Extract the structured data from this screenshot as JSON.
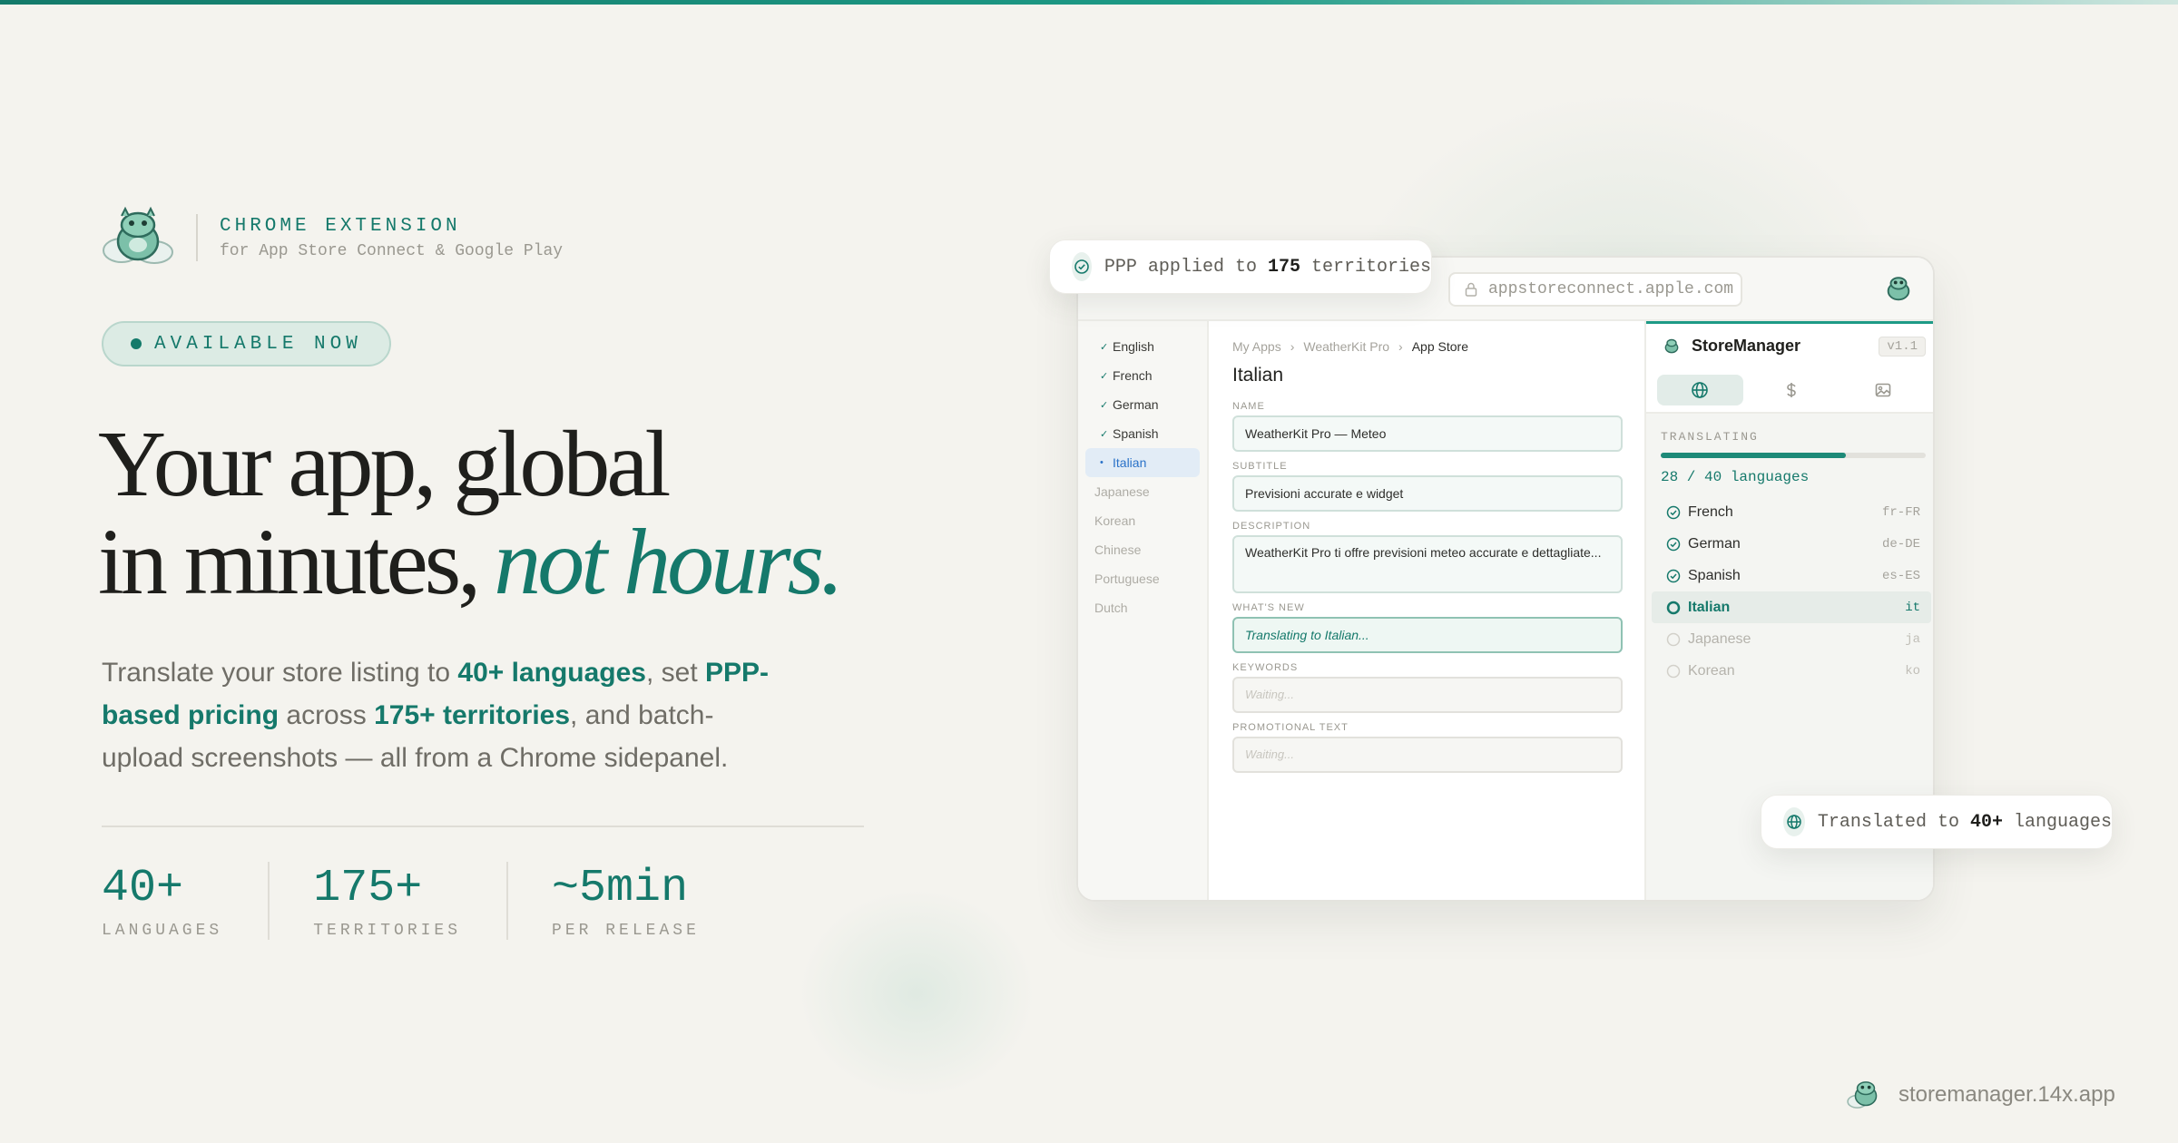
{
  "brand": {
    "title": "CHROME EXTENSION",
    "subtitle": "for App Store Connect & Google Play"
  },
  "availability": "AVAILABLE NOW",
  "headline": {
    "line1": "Your app, global",
    "line2": "in minutes,",
    "accent": "not hours."
  },
  "lede": {
    "part1": "Translate your store listing to ",
    "highlight1": "40+ languages",
    "part2": ", set ",
    "highlight2": "PPP-based pricing",
    "part3": " across ",
    "highlight3": "175+ territories",
    "part4": ", and batch-upload screenshots — all from a Chrome sidepanel."
  },
  "stats": [
    {
      "value": "40+",
      "label": "LANGUAGES"
    },
    {
      "value": "175+",
      "label": "TERRITORIES"
    },
    {
      "value": "~5min",
      "label": "PER RELEASE"
    }
  ],
  "footer": {
    "site": "storemanager.14x.app"
  },
  "browser": {
    "url": "appstoreconnect.apple.com",
    "nav_languages": [
      {
        "label": "English",
        "status": "done"
      },
      {
        "label": "French",
        "status": "done"
      },
      {
        "label": "German",
        "status": "done"
      },
      {
        "label": "Spanish",
        "status": "done"
      },
      {
        "label": "Italian",
        "status": "active"
      },
      {
        "label": "Japanese",
        "status": "pending"
      },
      {
        "label": "Korean",
        "status": "pending"
      },
      {
        "label": "Chinese",
        "status": "pending"
      },
      {
        "label": "Portuguese",
        "status": "pending"
      },
      {
        "label": "Dutch",
        "status": "pending"
      }
    ],
    "breadcrumb": [
      "My Apps",
      "WeatherKit Pro",
      "App Store"
    ],
    "page_title": "Italian",
    "fields": {
      "name_label": "NAME",
      "name_value": "WeatherKit Pro — Meteo",
      "subtitle_label": "SUBTITLE",
      "subtitle_value": "Previsioni accurate e widget",
      "description_label": "DESCRIPTION",
      "description_value": "WeatherKit Pro ti offre previsioni meteo accurate e dettagliate...",
      "whatsnew_label": "WHAT'S NEW",
      "whatsnew_value": "Translating to Italian...",
      "keywords_label": "KEYWORDS",
      "keywords_value": "Waiting...",
      "promo_label": "PROMOTIONAL TEXT",
      "promo_value": "Waiting..."
    }
  },
  "panel": {
    "name": "StoreManager",
    "version": "v1.1",
    "tabs": [
      {
        "icon": "globe-icon",
        "active": true
      },
      {
        "icon": "dollar-icon",
        "active": false
      },
      {
        "icon": "image-icon",
        "active": false
      }
    ],
    "progress_label": "TRANSLATING",
    "progress_text": "28 / 40 languages",
    "progress_fraction": 0.7,
    "languages": [
      {
        "name": "French",
        "code": "fr-FR",
        "status": "done"
      },
      {
        "name": "German",
        "code": "de-DE",
        "status": "done"
      },
      {
        "name": "Spanish",
        "code": "es-ES",
        "status": "done"
      },
      {
        "name": "Italian",
        "code": "it",
        "status": "current"
      },
      {
        "name": "Japanese",
        "code": "ja",
        "status": "pending"
      },
      {
        "name": "Korean",
        "code": "ko",
        "status": "pending"
      }
    ]
  },
  "badges": {
    "ppp": {
      "prefix": "PPP applied to ",
      "count": "175",
      "suffix": " territories"
    },
    "translated": {
      "prefix": "Translated to ",
      "count": "40+",
      "suffix": " languages"
    }
  },
  "colors": {
    "accent": "#15796b",
    "background": "#f4f3ee",
    "active_nav": "#2a72c8"
  }
}
